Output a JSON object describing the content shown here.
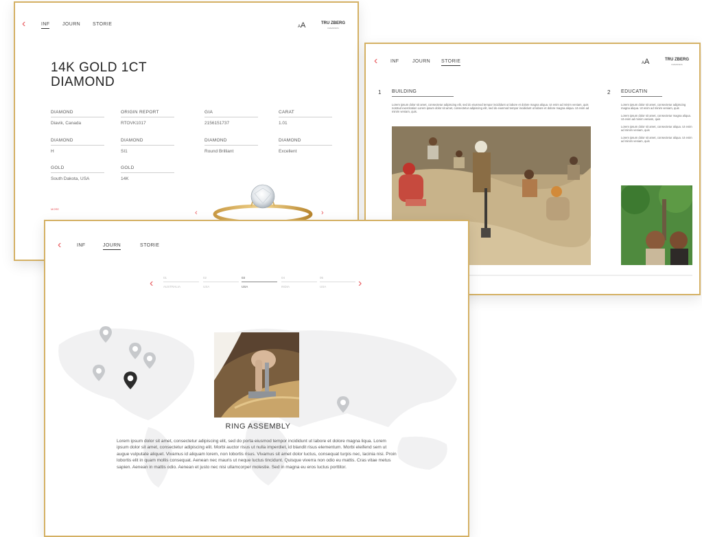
{
  "nav": {
    "tabs": [
      "INF",
      "JOURN",
      "STORIE"
    ],
    "font_size_label": "A",
    "font_size_small": "A",
    "brand_line1": "TRU ZBERG",
    "brand_line2": "DIAMONDS"
  },
  "info_screen": {
    "title_line1": "14K GOLD 1CT",
    "title_line2": "DIAMOND",
    "specs": [
      {
        "label": "DIAMOND",
        "value": "Diavik, Canada"
      },
      {
        "label": "ORIGIN REPORT",
        "value": "RTOVK1017"
      },
      {
        "label": "GIA",
        "value": "2156151737"
      },
      {
        "label": "CARAT",
        "value": "1.01"
      },
      {
        "label": "DIAMOND",
        "value": "H"
      },
      {
        "label": "DIAMOND",
        "value": "SI1"
      },
      {
        "label": "DIAMOND",
        "value": "Round Brilliant"
      },
      {
        "label": "DIAMOND",
        "value": "Excellent"
      },
      {
        "label": "GOLD",
        "value": "South Dakota, USA"
      },
      {
        "label": "GOLD",
        "value": "14K"
      }
    ],
    "small_tag": "MORE"
  },
  "stories_screen": {
    "sections": [
      {
        "number": "1",
        "heading": "BUILDING",
        "body": "Lorem ipsum dolor sit amet, consectetur adipiscing elit, sed do eiusmod tempor incididunt ut labore et dolore magna aliqua. Ut enim ad minim veniam, quis nostrud exercitation Lorem ipsum dolor sit amet, consectetur adipiscing elit, sed do eiusmod tempor incididunt ut labore et dolore magna aliqua. Ut enim ad minim veniam, quis."
      },
      {
        "number": "2",
        "heading": "EDUCATIN",
        "paragraphs": [
          "Lorem ipsum dolor sit amet, consectetur adipiscing magna aliqua. Ut enim ad minim veniam, quis",
          "Lorem ipsum dolor sit amet, consectetur magna aliqua. Ut enim ad minim veniam, quis",
          "Lorem ipsum dolor sit amet, consectetur aliqua. Ut enim ad minim veniam, quis",
          "Lorem ipsum dolor sit amet, consectetur aliqua. Ut enim ad minim veniam, quis"
        ]
      }
    ],
    "progress": 0.22,
    "colors": {
      "accent": "#ef5a5d",
      "frame": "#d4b063"
    }
  },
  "journey_screen": {
    "timeline": [
      {
        "step": "01",
        "place": "AUSTRALIA"
      },
      {
        "step": "02",
        "place": "USA"
      },
      {
        "step": "03",
        "place": "USA"
      },
      {
        "step": "04",
        "place": "INDIA"
      },
      {
        "step": "05",
        "place": "USA"
      }
    ],
    "active_step": 2,
    "section_title": "RING ASSEMBLY",
    "body": "Lorem ipsum dolor sit amet, consectetur adipiscing elit, sed do porta eiusmod tempor incididunt ut labore et dolore magna liqua. Lorem ipsum dolor sit amet, consectetur adipiscing elit. Morbi auctor risus ut nulla imperdiet, id blandit risus elementum. Morbi eleifend sem ut augue vulputate aliquet. Vivamus id aliquam lorem, non lobortis risus. Vivamus sit amet dolor luctus, consequat turpis nec, lacinia nisi. Proin lobortis elit in quam mollis consequat. Aenean nec mauris ut neque luctus tincidunt. Quisque viverra non odio eu mattis. Cras vitae metus sapien. Aenean in mattis odio. Aenean et justo nec nisi ullamcorper molestie. Sed in magna eu eros luctus porttitor."
  }
}
